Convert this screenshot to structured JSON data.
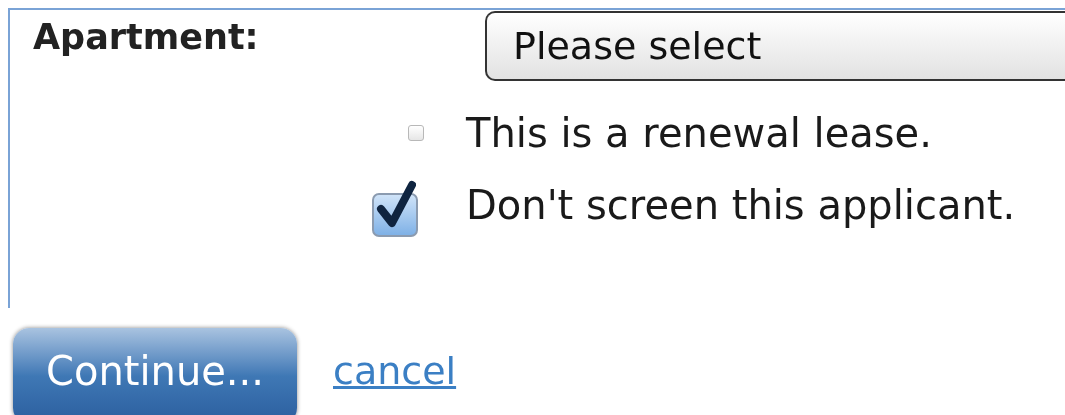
{
  "apartment": {
    "label": "Apartment:",
    "select": {
      "value": "Please select"
    }
  },
  "options": [
    {
      "kind": "plain",
      "label": "This is a renewal lease.",
      "checked": false
    },
    {
      "kind": "styled",
      "label": "Don't screen this applicant.",
      "checked": true
    }
  ],
  "actions": {
    "continue": "Continue...",
    "cancel": "cancel"
  }
}
